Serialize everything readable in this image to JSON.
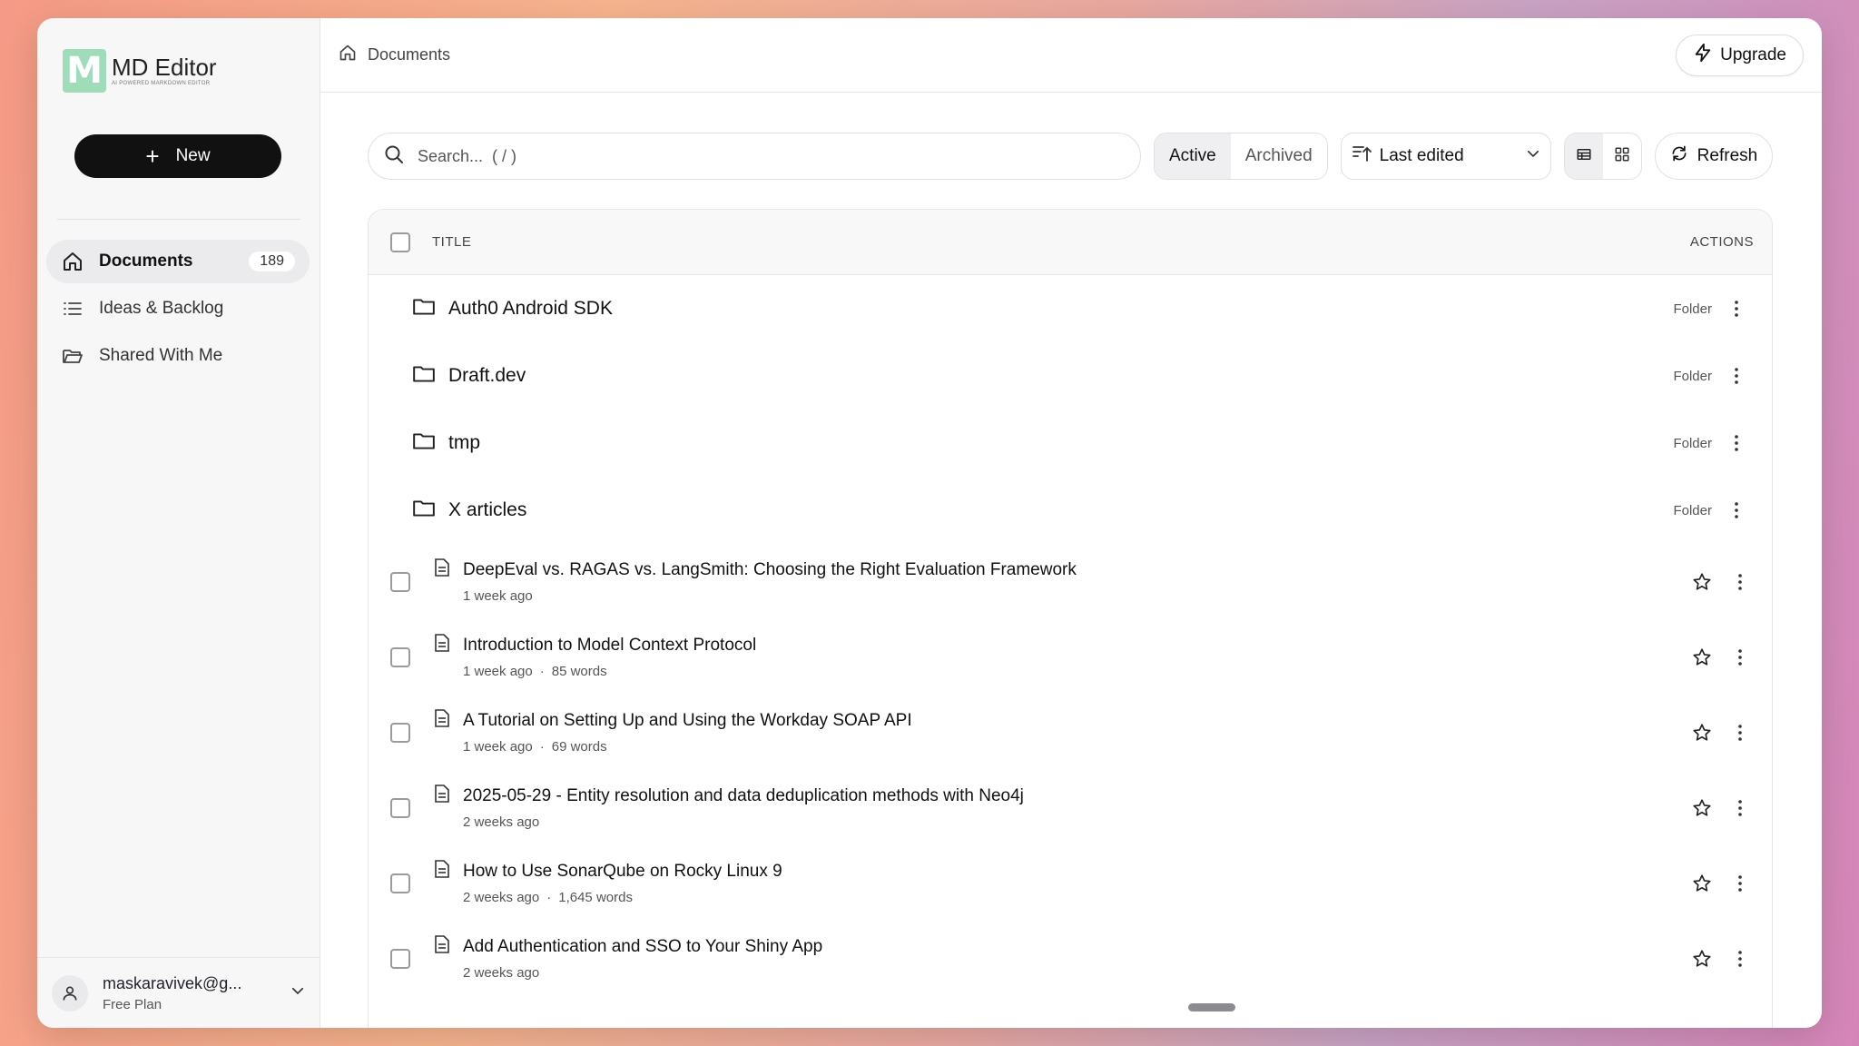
{
  "app": {
    "logo_letter": "M",
    "title": "MD Editor",
    "subtitle": "AI POWERED MARKDOWN EDITOR",
    "brand_color": "#9fdcb9"
  },
  "sidebar": {
    "new_label": "New",
    "items": [
      {
        "label": "Documents",
        "count": "189",
        "icon": "home-icon",
        "active": true
      },
      {
        "label": "Ideas & Backlog",
        "icon": "list-icon"
      },
      {
        "label": "Shared With Me",
        "icon": "folder-open-icon"
      }
    ],
    "user": {
      "email": "maskaravivek@g...",
      "plan": "Free Plan"
    }
  },
  "header": {
    "breadcrumb": "Documents",
    "upgrade_label": "Upgrade"
  },
  "toolbar": {
    "search_placeholder": "Search...  ( / )",
    "filters": [
      "Active",
      "Archived"
    ],
    "sort_label": "Last edited",
    "refresh_label": "Refresh"
  },
  "table": {
    "col_title": "TITLE",
    "col_actions": "ACTIONS",
    "folders": [
      {
        "name": "Auth0 Android SDK",
        "tag": "Folder"
      },
      {
        "name": "Draft.dev",
        "tag": "Folder"
      },
      {
        "name": "tmp",
        "tag": "Folder"
      },
      {
        "name": "X articles",
        "tag": "Folder"
      }
    ],
    "documents": [
      {
        "title": "DeepEval vs. RAGAS vs. LangSmith: Choosing the Right Evaluation Framework",
        "time": "1 week ago",
        "words": ""
      },
      {
        "title": "Introduction to Model Context Protocol",
        "time": "1 week ago",
        "words": "85 words"
      },
      {
        "title": "A Tutorial on Setting Up and Using the Workday SOAP API",
        "time": "1 week ago",
        "words": "69 words"
      },
      {
        "title": "2025-05-29 - Entity resolution and data deduplication methods with Neo4j",
        "time": "2 weeks ago",
        "words": ""
      },
      {
        "title": "How to Use SonarQube on Rocky Linux 9",
        "time": "2 weeks ago",
        "words": "1,645 words"
      },
      {
        "title": "Add Authentication and SSO to Your Shiny App",
        "time": "2 weeks ago",
        "words": ""
      }
    ]
  }
}
